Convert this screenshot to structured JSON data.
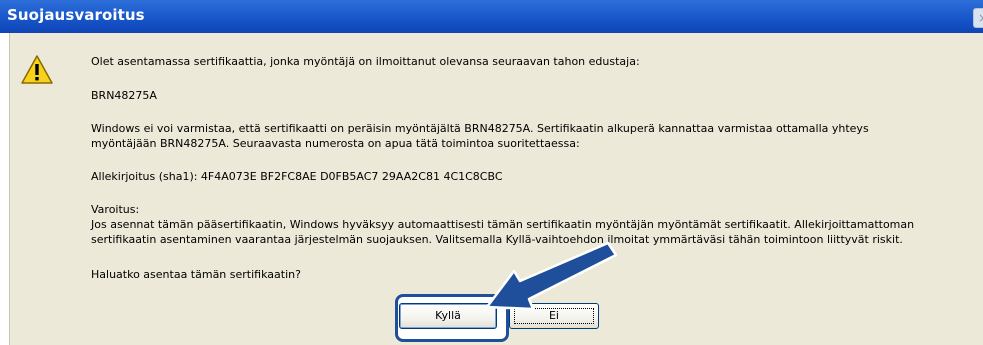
{
  "window": {
    "title": "Suojausvaroitus",
    "close_glyph": "×"
  },
  "icons": {
    "warning": "warning-triangle-icon",
    "pointer": "arrow-pointer-icon"
  },
  "message": {
    "intro": "Olet asentamassa sertifikaattia, jonka myöntäjä on ilmoittanut olevansa seuraavan tahon edustaja:",
    "issuer": "BRN48275A",
    "verify_line1": "Windows ei voi varmistaa, että sertifikaatti on peräisin myöntäjältä BRN48275A. Sertifikaatin alkuperä kannattaa varmistaa ottamalla yhteys",
    "verify_line2": "myöntäjään BRN48275A. Seuraavasta numerosta on apua tätä toimintoa suoritettaessa:",
    "signature": "Allekirjoitus (sha1): 4F4A073E BF2FC8AE D0FB5AC7 29AA2C81 4C1C8CBC",
    "warning_heading": "Varoitus:",
    "warning_line1": "Jos asennat tämän pääsertifikaatin, Windows hyväksyy automaattisesti tämän sertifikaatin myöntäjän myöntämät sertifikaatit. Allekirjoittamattoman",
    "warning_line2": "sertifikaatin asentaminen vaarantaa järjestelmän suojauksen. Valitsemalla Kyllä-vaihtoehdon ilmoitat ymmärtäväsi tähän toimintoon liittyvät riskit.",
    "question": "Haluatko asentaa tämän sertifikaatin?"
  },
  "buttons": {
    "yes": "Kyllä",
    "no": "Ei"
  },
  "colors": {
    "titlebar": "#1450c4",
    "dialog_bg": "#ece9d8",
    "annotation": "#1f4f9a"
  }
}
